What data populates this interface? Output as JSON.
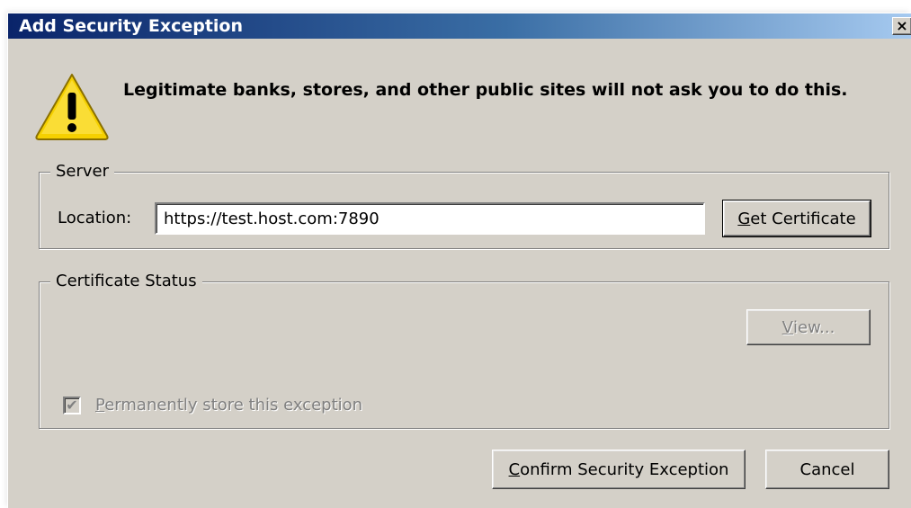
{
  "window": {
    "title": "Add Security Exception",
    "close_glyph": "×"
  },
  "warning": {
    "icon": "warning-triangle-icon",
    "headline": "Legitimate banks, stores, and other public sites will not ask you to do this."
  },
  "server": {
    "legend": "Server",
    "location_label": "Location:",
    "location_value": "https://test.host.com:7890",
    "get_certificate": {
      "mnemonic": "G",
      "rest": "et Certificate"
    }
  },
  "certificate_status": {
    "legend": "Certificate Status",
    "view": {
      "mnemonic": "V",
      "rest": "iew..."
    },
    "permanent_checkbox": {
      "checked": true,
      "mnemonic": "P",
      "rest": "ermanently store this exception"
    }
  },
  "footer": {
    "confirm": {
      "mnemonic": "C",
      "rest": "onfirm Security Exception"
    },
    "cancel": "Cancel"
  },
  "colors": {
    "dialog_bg": "#d4d0c8",
    "title_gradient_start": "#0a246a",
    "title_gradient_end": "#a6caf0",
    "warning_yellow": "#f5d000",
    "disabled_text": "#808080"
  }
}
